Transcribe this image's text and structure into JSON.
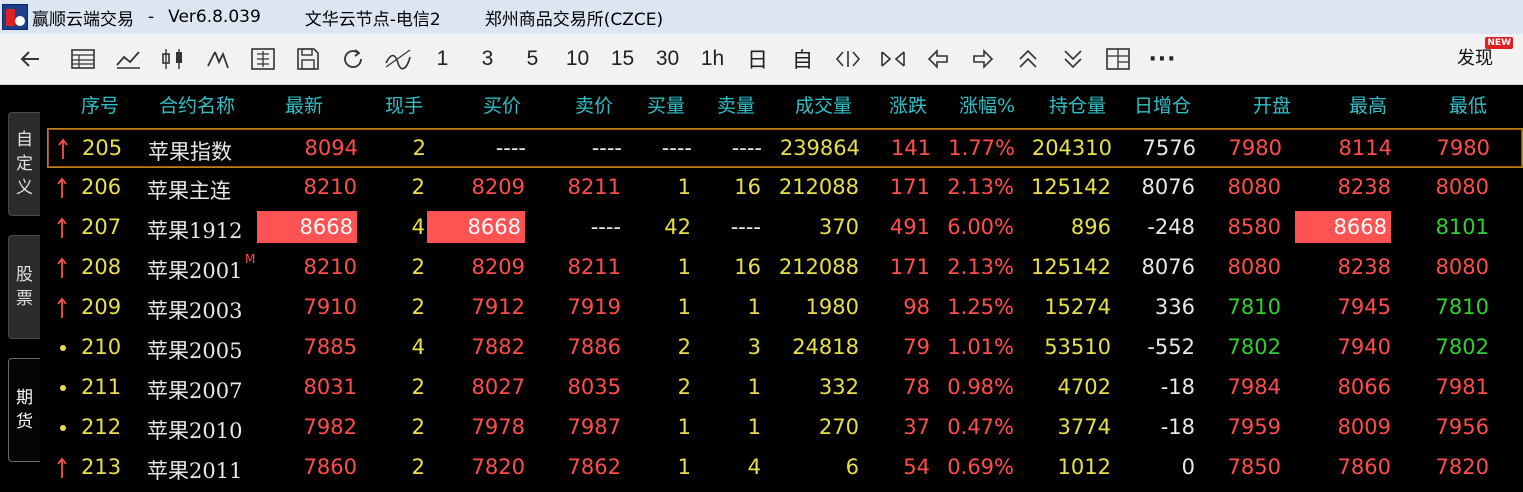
{
  "titlebar": {
    "app_name": "赢顺云端交易",
    "separator": "-",
    "version": "Ver6.8.039",
    "node": "文华云节点-电信2",
    "exchange": "郑州商品交易所(CZCE)"
  },
  "toolbar": {
    "periods": [
      "1",
      "3",
      "5",
      "10",
      "15",
      "30",
      "1h",
      "日",
      "自"
    ],
    "discover_label": "发现",
    "new_badge": "NEW"
  },
  "sidebar": {
    "tabs": [
      "自定义",
      "股票",
      "期货"
    ],
    "active": "期货"
  },
  "table": {
    "headers": [
      "序号",
      "合约名称",
      "最新",
      "现手",
      "买价",
      "卖价",
      "买量",
      "卖量",
      "成交量",
      "涨跌",
      "涨幅%",
      "持仓量",
      "日增仓",
      "开盘",
      "最高",
      "最低"
    ],
    "rows": [
      {
        "marker": "up",
        "seq": "205",
        "name": "苹果指数",
        "sup": "",
        "last": "8094",
        "hand": "2",
        "bid": "----",
        "ask": "----",
        "bidvol": "----",
        "askvol": "----",
        "vol": "239864",
        "chg": "141",
        "pct": "1.77%",
        "oi": "204310",
        "dayoi": "7576",
        "open": "7980",
        "high": "8114",
        "low": "7980"
      },
      {
        "marker": "up",
        "seq": "206",
        "name": "苹果主连",
        "sup": "",
        "last": "8210",
        "hand": "2",
        "bid": "8209",
        "ask": "8211",
        "bidvol": "1",
        "askvol": "16",
        "vol": "212088",
        "chg": "171",
        "pct": "2.13%",
        "oi": "125142",
        "dayoi": "8076",
        "open": "8080",
        "high": "8238",
        "low": "8080"
      },
      {
        "marker": "up",
        "seq": "207",
        "name": "苹果1912",
        "sup": "",
        "last": "8668",
        "hand": "4",
        "bid": "8668",
        "ask": "----",
        "bidvol": "42",
        "askvol": "----",
        "vol": "370",
        "chg": "491",
        "pct": "6.00%",
        "oi": "896",
        "dayoi": "-248",
        "open": "8580",
        "high": "8668",
        "low": "8101"
      },
      {
        "marker": "up",
        "seq": "208",
        "name": "苹果2001",
        "sup": "M",
        "last": "8210",
        "hand": "2",
        "bid": "8209",
        "ask": "8211",
        "bidvol": "1",
        "askvol": "16",
        "vol": "212088",
        "chg": "171",
        "pct": "2.13%",
        "oi": "125142",
        "dayoi": "8076",
        "open": "8080",
        "high": "8238",
        "low": "8080"
      },
      {
        "marker": "up",
        "seq": "209",
        "name": "苹果2003",
        "sup": "",
        "last": "7910",
        "hand": "2",
        "bid": "7912",
        "ask": "7919",
        "bidvol": "1",
        "askvol": "1",
        "vol": "1980",
        "chg": "98",
        "pct": "1.25%",
        "oi": "15274",
        "dayoi": "336",
        "open": "7810",
        "high": "7945",
        "low": "7810"
      },
      {
        "marker": "dot",
        "seq": "210",
        "name": "苹果2005",
        "sup": "",
        "last": "7885",
        "hand": "4",
        "bid": "7882",
        "ask": "7886",
        "bidvol": "2",
        "askvol": "3",
        "vol": "24818",
        "chg": "79",
        "pct": "1.01%",
        "oi": "53510",
        "dayoi": "-552",
        "open": "7802",
        "high": "7940",
        "low": "7802"
      },
      {
        "marker": "dot",
        "seq": "211",
        "name": "苹果2007",
        "sup": "",
        "last": "8031",
        "hand": "2",
        "bid": "8027",
        "ask": "8035",
        "bidvol": "2",
        "askvol": "1",
        "vol": "332",
        "chg": "78",
        "pct": "0.98%",
        "oi": "4702",
        "dayoi": "-18",
        "open": "7984",
        "high": "8066",
        "low": "7981"
      },
      {
        "marker": "dot",
        "seq": "212",
        "name": "苹果2010",
        "sup": "",
        "last": "7982",
        "hand": "2",
        "bid": "7978",
        "ask": "7987",
        "bidvol": "1",
        "askvol": "1",
        "vol": "270",
        "chg": "37",
        "pct": "0.47%",
        "oi": "3774",
        "dayoi": "-18",
        "open": "7959",
        "high": "8009",
        "low": "7956"
      },
      {
        "marker": "up",
        "seq": "213",
        "name": "苹果2011",
        "sup": "",
        "last": "7860",
        "hand": "2",
        "bid": "7820",
        "ask": "7862",
        "bidvol": "1",
        "askvol": "4",
        "vol": "6",
        "chg": "54",
        "pct": "0.69%",
        "oi": "1012",
        "dayoi": "0",
        "open": "7850",
        "high": "7860",
        "low": "7820"
      }
    ]
  },
  "colors": {
    "up": "#ff4d4d",
    "neutral": "#e8e04a",
    "down": "#2fd02f",
    "header": "#2ec0c6",
    "highlight_bg": "#ff5252"
  }
}
